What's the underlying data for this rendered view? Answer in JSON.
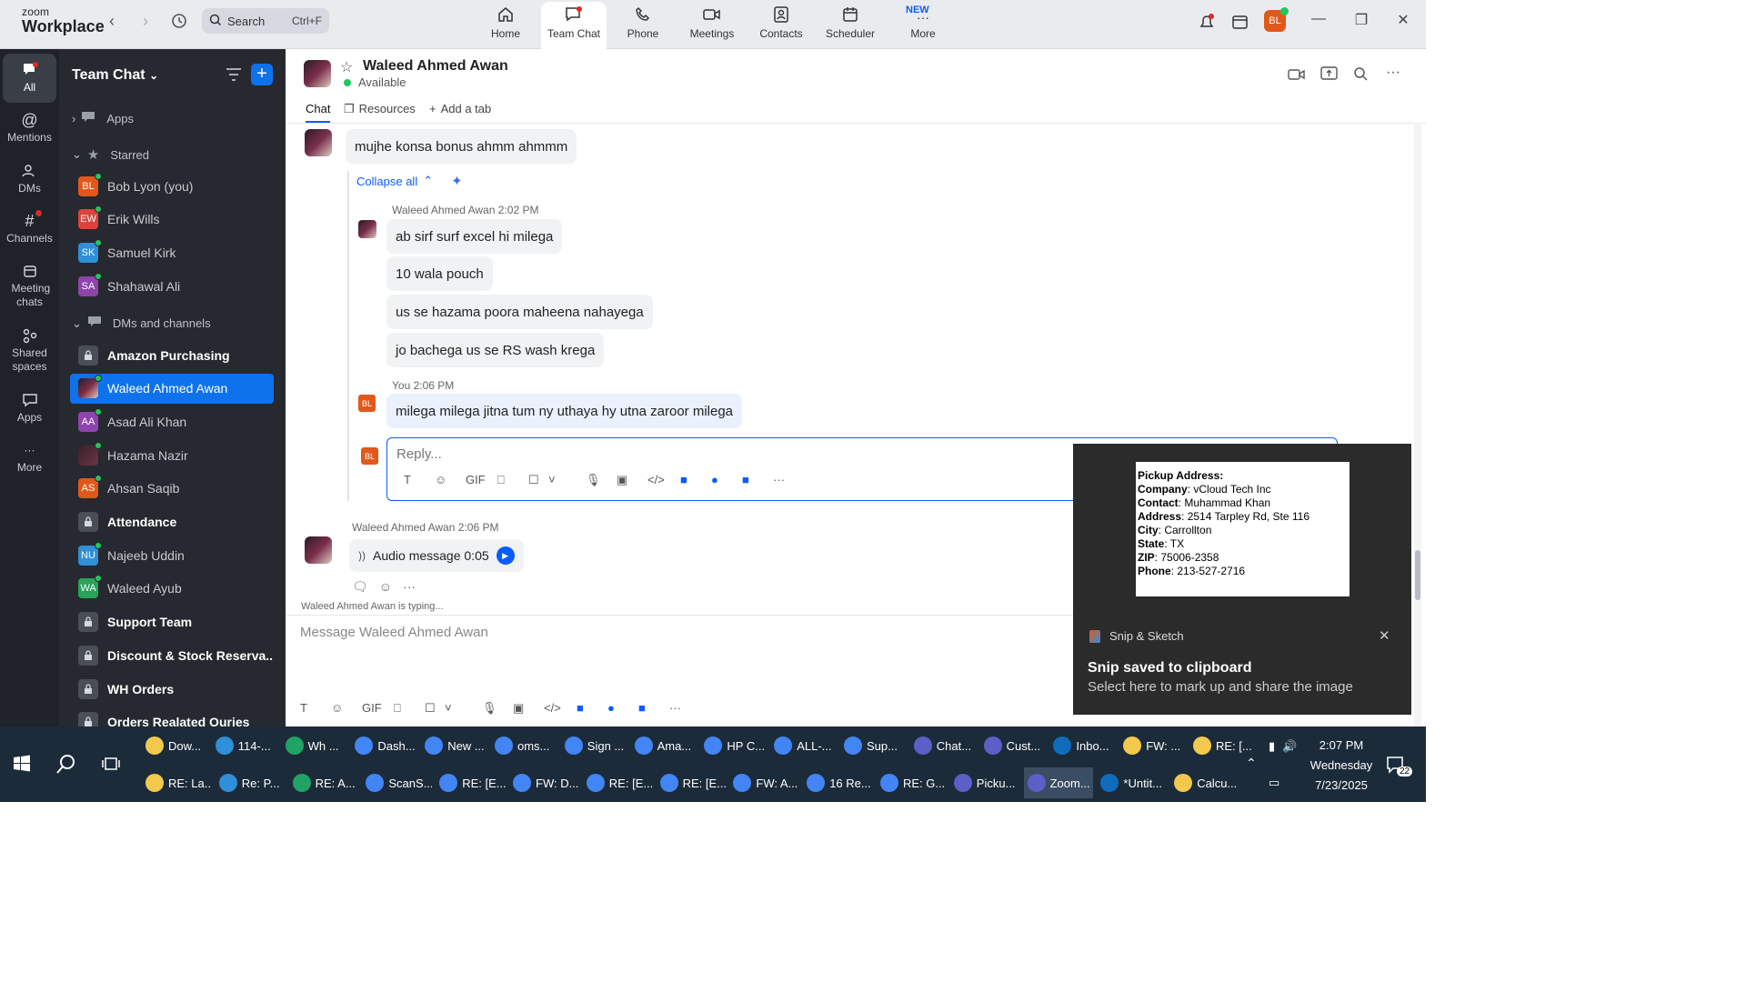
{
  "app": {
    "logo_line1": "zoom",
    "logo_line2": "Workplace"
  },
  "search": {
    "label": "Search",
    "shortcut": "Ctrl+F"
  },
  "nav": [
    {
      "label": "Home",
      "icon": "home-icon"
    },
    {
      "label": "Team Chat",
      "icon": "chat-icon"
    },
    {
      "label": "Phone",
      "icon": "phone-icon"
    },
    {
      "label": "Meetings",
      "icon": "video-icon"
    },
    {
      "label": "Contacts",
      "icon": "contacts-icon"
    },
    {
      "label": "Scheduler",
      "icon": "calendar-icon"
    },
    {
      "label": "More",
      "icon": "more-icon",
      "badge": "NEW"
    }
  ],
  "user_avatar": "BL",
  "rail": [
    {
      "label": "All"
    },
    {
      "label": "Mentions"
    },
    {
      "label": "DMs"
    },
    {
      "label": "Channels"
    },
    {
      "label": "Meeting chats"
    },
    {
      "label": "Shared spaces"
    },
    {
      "label": "Apps"
    },
    {
      "label": "More"
    }
  ],
  "sidebar": {
    "title": "Team Chat",
    "apps_label": "Apps",
    "starred_label": "Starred",
    "starred": [
      {
        "initials": "BL",
        "name": "Bob Lyon (you)",
        "color": "#e2581b"
      },
      {
        "initials": "EW",
        "name": "Erik Wills",
        "color": "#d9453a"
      },
      {
        "initials": "SK",
        "name": "Samuel Kirk",
        "color": "#2f8fd8"
      },
      {
        "initials": "SA",
        "name": "Shahawal Ali",
        "color": "#8e44ad"
      }
    ],
    "dms_label": "DMs and channels",
    "dms": [
      {
        "initials": "",
        "name": "Amazon Purchasing",
        "type": "channel"
      },
      {
        "initials": "",
        "name": "Waleed Ahmed Awan",
        "type": "photo",
        "selected": true
      },
      {
        "initials": "AA",
        "name": "Asad Ali Khan",
        "color": "#8e44ad"
      },
      {
        "initials": "",
        "name": "Hazama Nazir",
        "type": "photo2"
      },
      {
        "initials": "AS",
        "name": "Ahsan Saqib",
        "color": "#e2581b"
      },
      {
        "initials": "",
        "name": "Attendance",
        "type": "channel"
      },
      {
        "initials": "NU",
        "name": "Najeeb Uddin",
        "color": "#2f8fd8"
      },
      {
        "initials": "WA",
        "name": "Waleed Ayub",
        "color": "#27a35a"
      },
      {
        "initials": "",
        "name": "Support Team",
        "type": "channel"
      },
      {
        "initials": "",
        "name": "Discount & Stock Reserva...",
        "type": "channel"
      },
      {
        "initials": "",
        "name": "WH Orders",
        "type": "channel"
      },
      {
        "initials": "",
        "name": "Orders Realated Ouries",
        "type": "channel"
      }
    ]
  },
  "chat": {
    "name": "Waleed Ahmed Awan",
    "status": "Available",
    "tabs": [
      "Chat",
      "Resources",
      "Add a tab"
    ],
    "first_msg": "mujhe konsa bonus ahmm ahmmm",
    "collapse_all": "Collapse all",
    "thread_meta1_name": "Waleed Ahmed Awan",
    "thread_meta1_time": "2:02 PM",
    "thread_msgs": [
      "ab sirf surf excel hi milega",
      "10 wala pouch",
      "us se hazama poora maheena nahayega",
      "jo bachega us se RS wash krega"
    ],
    "thread_meta2_name": "You",
    "thread_meta2_time": "2:06 PM",
    "my_msg": "milega milega jitna tum ny uthaya hy utna zaroor milega",
    "reply_placeholder": "Reply...",
    "audio_meta_name": "Waleed Ahmed Awan",
    "audio_meta_time": "2:06 PM",
    "audio_label": "Audio message 0:05",
    "typing": "Waleed Ahmed Awan is typing...",
    "compose_placeholder": "Message Waleed Ahmed Awan",
    "gif_label": "GIF"
  },
  "toast": {
    "app": "Snip & Sketch",
    "title": "Snip saved to clipboard",
    "body": "Select here to mark up and share the image",
    "img": {
      "heading": "Pickup Address:",
      "company_k": "Company",
      "company_v": "vCloud Tech Inc",
      "contact_k": "Contact",
      "contact_v": "Muhammad Khan",
      "address_k": "Address",
      "address_v": "2514 Tarpley Rd, Ste 116",
      "city_k": "City",
      "city_v": "Carrollton",
      "state_k": "State",
      "state_v": "TX",
      "zip_k": "ZIP",
      "zip_v": "75006-2358",
      "phone_k": "Phone",
      "phone_v": "213-527-2716"
    }
  },
  "taskbar": {
    "row1": [
      "Dow...",
      "114-...",
      "Wh ...",
      "Dash...",
      "New ...",
      "oms...",
      "Sign ...",
      "Ama...",
      "HP C...",
      "ALL-...",
      "Sup...",
      "Chat...",
      "Cust...",
      "Inbo...",
      "FW: ...",
      "RE: [..."
    ],
    "row2": [
      "RE: La...",
      "Re: P...",
      "RE: A...",
      "ScanS...",
      "RE: [E...",
      "FW: D...",
      "RE: [E...",
      "RE: [E...",
      "FW: A...",
      "16 Re...",
      "RE: G...",
      "Picku...",
      "Zoom...",
      "*Untit...",
      "Calcu..."
    ],
    "time": "2:07 PM",
    "day": "Wednesday",
    "date": "7/23/2025",
    "notif_count": "22"
  }
}
